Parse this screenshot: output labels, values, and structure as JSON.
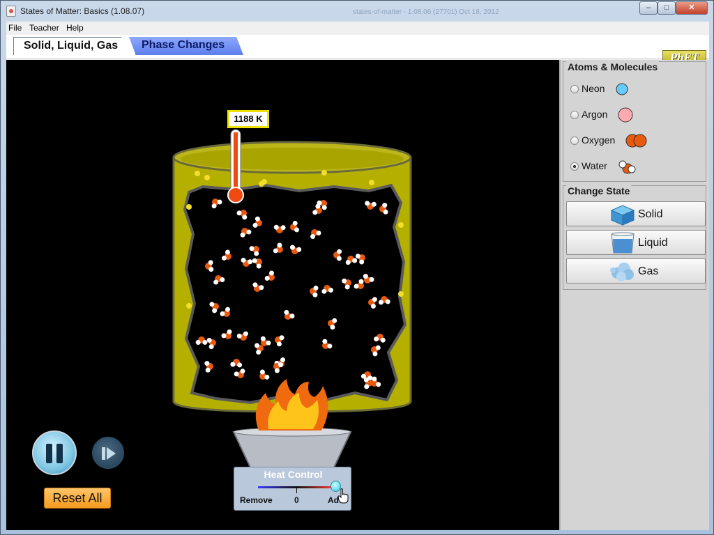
{
  "window": {
    "title": "States of Matter: Basics (1.08.07)",
    "background_title": "states-of-matter - 1.08.06 (27701) Oct 18, 2012"
  },
  "menu": {
    "file": "File",
    "teacher": "Teacher",
    "help": "Help"
  },
  "tabs": [
    {
      "label": "Solid, Liquid, Gas",
      "selected": true
    },
    {
      "label": "Phase Changes",
      "selected": false
    }
  ],
  "logo": "PhET",
  "temperature": "1188 K",
  "heat_control": {
    "title": "Heat Control",
    "remove": "Remove",
    "zero": "0",
    "add": "Add",
    "level": 1.0
  },
  "atoms_molecules": {
    "title": "Atoms & Molecules",
    "options": [
      {
        "label": "Neon",
        "selected": false,
        "color": "#66ccff"
      },
      {
        "label": "Argon",
        "selected": false,
        "color": "#ffaab0"
      },
      {
        "label": "Oxygen",
        "selected": false,
        "color": "#e85a10"
      },
      {
        "label": "Water",
        "selected": true,
        "color": "#e85a10"
      }
    ]
  },
  "change_state": {
    "title": "Change State",
    "buttons": [
      "Solid",
      "Liquid",
      "Gas"
    ]
  },
  "controls": {
    "reset_all": "Reset All"
  },
  "colors": {
    "container": "#b8b400",
    "sim_background": "#000000",
    "molecule_oxygen": "#e85a10",
    "molecule_hydrogen": "#ffffff"
  }
}
